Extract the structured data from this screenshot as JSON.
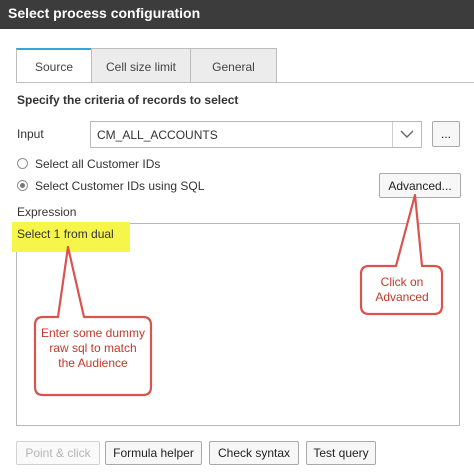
{
  "window": {
    "title": "Select process configuration"
  },
  "tabs": [
    {
      "label": "Source",
      "active": true
    },
    {
      "label": "Cell size limit",
      "active": false
    },
    {
      "label": "General",
      "active": false
    }
  ],
  "source": {
    "heading": "Specify the criteria of records to select",
    "input_label": "Input",
    "input_value": "CM_ALL_ACCOUNTS",
    "browse_label": "...",
    "radio_all_label": "Select all Customer IDs",
    "radio_sql_label": "Select Customer IDs using SQL",
    "selected_radio": "sql",
    "advanced_label": "Advanced...",
    "expression_label": "Expression",
    "expression_value": "Select 1 from dual"
  },
  "buttons": {
    "point_click": "Point & click",
    "formula_helper": "Formula helper",
    "check_syntax": "Check syntax",
    "test_query": "Test query"
  },
  "annotations": {
    "callout_advanced": "Click on Advanced",
    "callout_sql": "Enter some dummy raw sql to match the Audience",
    "color": "#d9534f",
    "highlight_color": "#f6f64a"
  },
  "colors": {
    "titlebar": "#3c3c3c",
    "tab_accent": "#34a6d8"
  }
}
